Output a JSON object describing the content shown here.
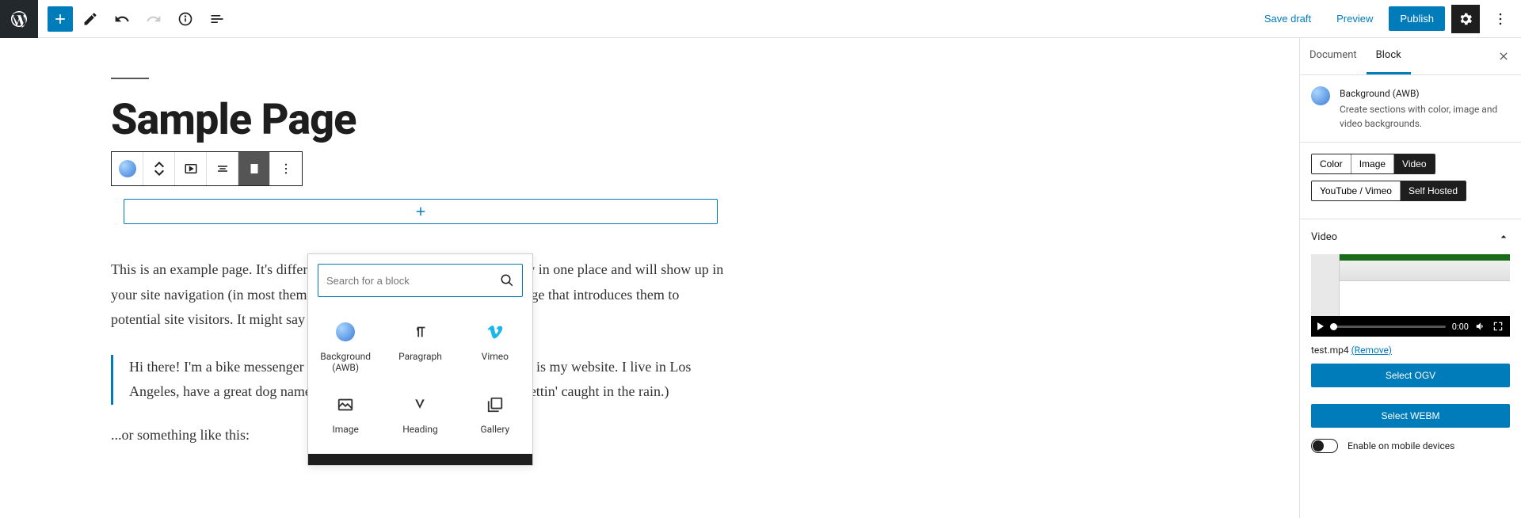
{
  "toolbar": {
    "save_draft": "Save draft",
    "preview": "Preview",
    "publish": "Publish"
  },
  "editor": {
    "page_title": "Sample Page",
    "paragraph1": "This is an example page. It's different from a blog post because it will stay in one place and will show up in your site navigation (in most themes). Most people start with an About page that introduces them to potential site visitors. It might say something like this:",
    "quote": "Hi there! I'm a bike messenger by day, aspiring actor by night, and this is my website. I live in Los Angeles, have a great dog named Jack, and I like piña coladas. (And gettin' caught in the rain.)",
    "paragraph2": "...or something like this:"
  },
  "inserter": {
    "search_placeholder": "Search for a block",
    "items": [
      {
        "label": "Background (AWB)"
      },
      {
        "label": "Paragraph"
      },
      {
        "label": "Vimeo"
      },
      {
        "label": "Image"
      },
      {
        "label": "Heading"
      },
      {
        "label": "Gallery"
      }
    ]
  },
  "sidebar": {
    "tabs": {
      "document": "Document",
      "block": "Block"
    },
    "block_title": "Background (AWB)",
    "block_desc": "Create sections with color, image and video backgrounds.",
    "bg_type": {
      "color": "Color",
      "image": "Image",
      "video": "Video"
    },
    "source": {
      "youtube": "YouTube / Vimeo",
      "self": "Self Hosted"
    },
    "video_panel": "Video",
    "video_time": "0:00",
    "file_name": "test.mp4",
    "remove": "(Remove)",
    "select_ogv": "Select OGV",
    "select_webm": "Select WEBM",
    "enable_mobile": "Enable on mobile devices"
  }
}
